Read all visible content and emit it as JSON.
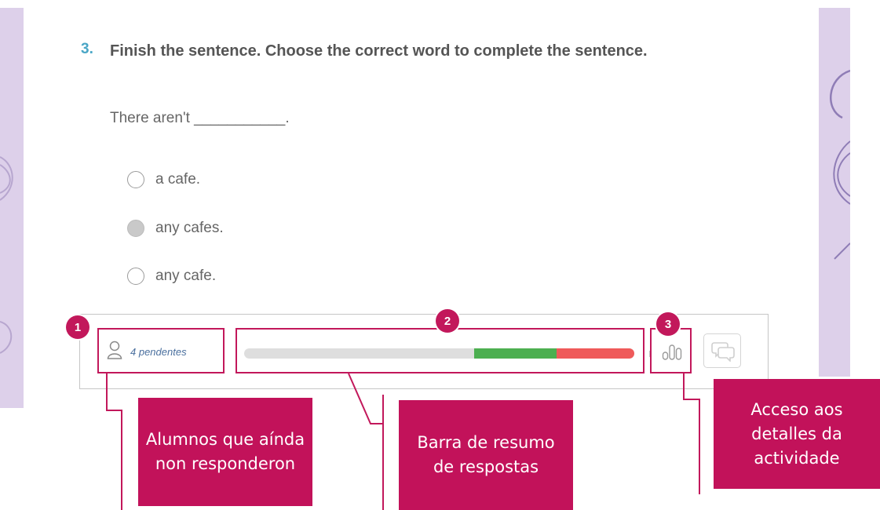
{
  "question": {
    "number": "3.",
    "prompt": "Finish the sentence. Choose the correct word to complete the sentence.",
    "sentence": "There aren't ___________.",
    "options": [
      {
        "label": "a cafe.",
        "selected": false
      },
      {
        "label": "any cafes.",
        "selected": true
      },
      {
        "label": "any cafe.",
        "selected": false
      }
    ]
  },
  "toolbar": {
    "pending_text": "4 pendentes",
    "progress": {
      "green_start": 0.59,
      "green_end": 0.8,
      "red_end": 1.0
    },
    "stats_icon": "bar-chart-icon",
    "chat_icon": "chat-icon"
  },
  "markers": [
    "1",
    "2",
    "3"
  ],
  "annotations": {
    "pending": "Alumnos que aínda non responderon",
    "progress": "Barra de resumo de respostas",
    "details": "Acceso aos detalles da actividade"
  },
  "colors": {
    "accent": "#c2185b",
    "question_number": "#4aa6c6",
    "correct": "#4caf50",
    "wrong": "#ef5a5a",
    "side_panel": "#ddd0ea"
  }
}
